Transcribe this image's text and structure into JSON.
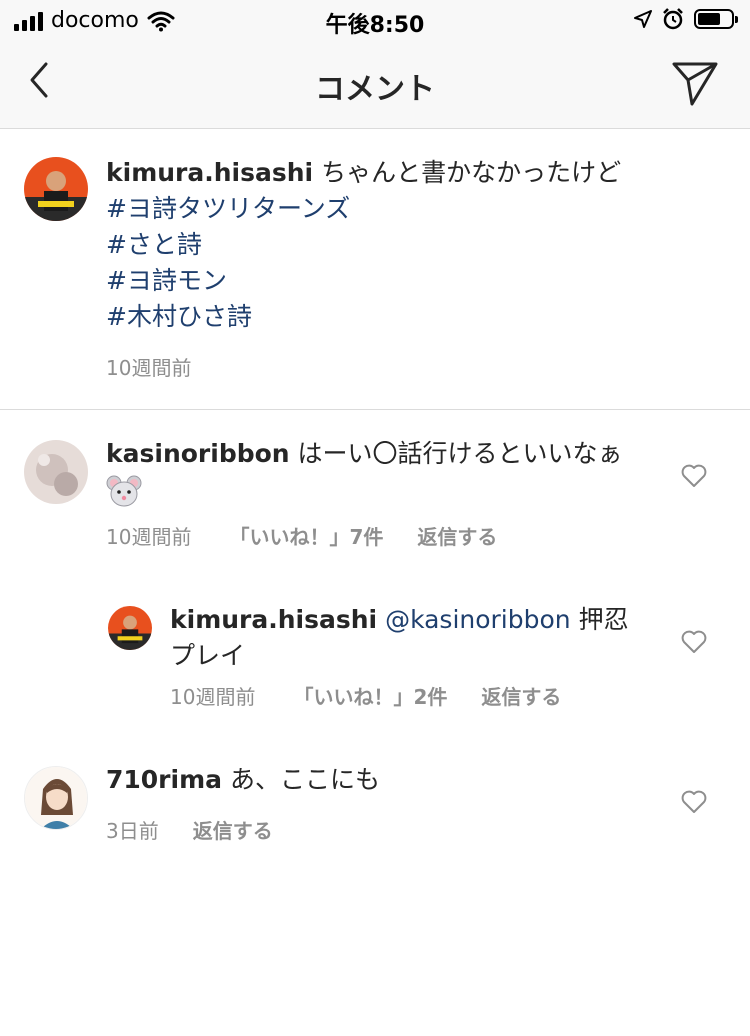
{
  "status_bar": {
    "carrier": "docomo",
    "time": "午後8:50",
    "icons": [
      "signal-icon",
      "wifi-icon",
      "location-icon",
      "alarm-icon",
      "battery-icon"
    ],
    "battery_level": 0.7
  },
  "header": {
    "title": "コメント",
    "back_icon": "chevron-left-icon",
    "send_icon": "paper-plane-icon"
  },
  "caption": {
    "username": "kimura.hisashi",
    "text": "ちゃんと書かなかったけど",
    "hashtags": [
      "#ヨ詩タツリターンズ",
      "#さと詩",
      "#ヨ詩モン",
      "#木村ひさ詩"
    ],
    "time": "10週間前"
  },
  "comments": [
    {
      "username": "kasinoribbon",
      "text": "はーい〇話行けるといいなぁ",
      "emoji": "mouse-face-emoji",
      "time": "10週間前",
      "likes": "「いいね！」7件",
      "reply": "返信する"
    },
    {
      "username": "kimura.hisashi",
      "mention": "@kasinoribbon",
      "text_line1": "押忍",
      "text_line2": "プレイ",
      "time": "10週間前",
      "likes": "「いいね！」2件",
      "reply": "返信する"
    },
    {
      "username": "710rima",
      "text": "あ、ここにも",
      "time": "3日前",
      "reply": "返信する"
    }
  ],
  "colors": {
    "hashtag": "#1f3f6e",
    "meta": "#8e8e8e",
    "bar_bg": "#f8f8f8",
    "accent_orange": "#e8501e"
  }
}
